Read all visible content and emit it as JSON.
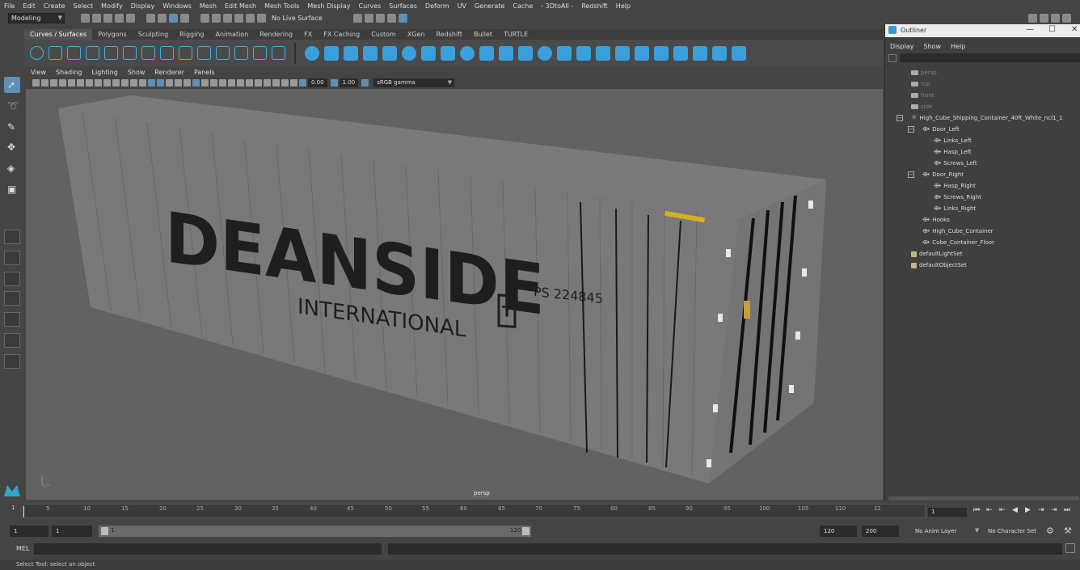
{
  "menubar": [
    "File",
    "Edit",
    "Create",
    "Select",
    "Modify",
    "Display",
    "Windows",
    "Mesh",
    "Edit Mesh",
    "Mesh Tools",
    "Mesh Display",
    "Curves",
    "Surfaces",
    "Deform",
    "UV",
    "Generate",
    "Cache",
    "- 3DtoAll -",
    "Redshift",
    "Help"
  ],
  "statusline": {
    "mode": "Modeling",
    "live_surface": "No Live Surface"
  },
  "shelf_tabs": [
    "Curves / Surfaces",
    "Polygons",
    "Sculpting",
    "Rigging",
    "Animation",
    "Rendering",
    "FX",
    "FX Caching",
    "Custom",
    "XGen",
    "Redshift",
    "Bullet",
    "TURTLE"
  ],
  "viewport": {
    "menu": [
      "View",
      "Shading",
      "Lighting",
      "Show",
      "Renderer",
      "Panels"
    ],
    "near_value": "0.00",
    "far_value": "1.00",
    "color_space": "sRGB gamma",
    "camera_label": "persp",
    "container": {
      "brand": "DEANSIDE",
      "sub": "INTERNATIONAL",
      "code": "PS 224845",
      "logo_letter": "T"
    }
  },
  "outliner": {
    "title": "Outliner",
    "menu": [
      "Display",
      "Show",
      "Help"
    ],
    "items": [
      {
        "label": "persp"
      },
      {
        "label": "top"
      },
      {
        "label": "front"
      },
      {
        "label": "side"
      },
      {
        "label": "High_Cube_Shipping_Container_40ft_White_ncl1_1"
      },
      {
        "label": "Door_Left"
      },
      {
        "label": "Links_Left"
      },
      {
        "label": "Hasp_Left"
      },
      {
        "label": "Screws_Left"
      },
      {
        "label": "Door_Right"
      },
      {
        "label": "Hasp_Right"
      },
      {
        "label": "Screws_Right"
      },
      {
        "label": "Links_Right"
      },
      {
        "label": "Hooks"
      },
      {
        "label": "High_Cube_Container"
      },
      {
        "label": "Cube_Container_Floor"
      },
      {
        "label": "defaultLightSet"
      },
      {
        "label": "defaultObjectSet"
      }
    ]
  },
  "timeline": {
    "ticks": [
      "5",
      "10",
      "15",
      "20",
      "25",
      "30",
      "35",
      "40",
      "45",
      "50",
      "55",
      "60",
      "65",
      "70",
      "75",
      "80",
      "85",
      "90",
      "95",
      "100",
      "105",
      "110",
      "11"
    ],
    "first_tick": "1",
    "current_frame": "1"
  },
  "range": {
    "start": "1",
    "start2": "1",
    "inner_start": "1",
    "inner_end": "120",
    "end": "120",
    "end2": "200",
    "anim_layer": "No Anim Layer",
    "char_set": "No Character Set"
  },
  "mel": {
    "label": "MEL"
  },
  "help_line": "Select Tool: select an object",
  "colors": {
    "accent": "#5e8fb5",
    "shelf_icon": "#3aa0dd"
  }
}
